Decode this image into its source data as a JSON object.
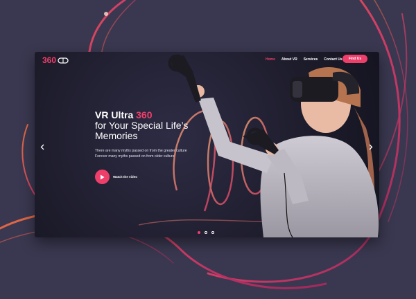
{
  "brand": {
    "logo_text": "360",
    "accent": "#ee3f6b"
  },
  "nav": {
    "items": [
      {
        "label": "Home",
        "active": true
      },
      {
        "label": "About VR",
        "active": false
      },
      {
        "label": "Services",
        "active": false
      },
      {
        "label": "Contact Us",
        "active": false
      }
    ],
    "cta_label": "Find Us"
  },
  "hero": {
    "title_part1": "VR Ultra ",
    "title_accent": "360",
    "title_line2": "for Your Special Life’s",
    "title_line3": "Memories",
    "desc_line1": "There are many myths passed on from the greater culture",
    "desc_line2": "Forever many myths passed on from older culture",
    "watch_label": "Watch the video"
  },
  "slider": {
    "total_slides": 3,
    "active_slide": 1
  },
  "icons": {
    "prev": "chevron-left-icon",
    "next": "chevron-right-icon",
    "play": "play-icon",
    "logo_mark": "infinity-loop-icon"
  },
  "colors": {
    "background": "#3a3850",
    "panel": "#1b1a28",
    "accent": "#ee3f6b"
  }
}
